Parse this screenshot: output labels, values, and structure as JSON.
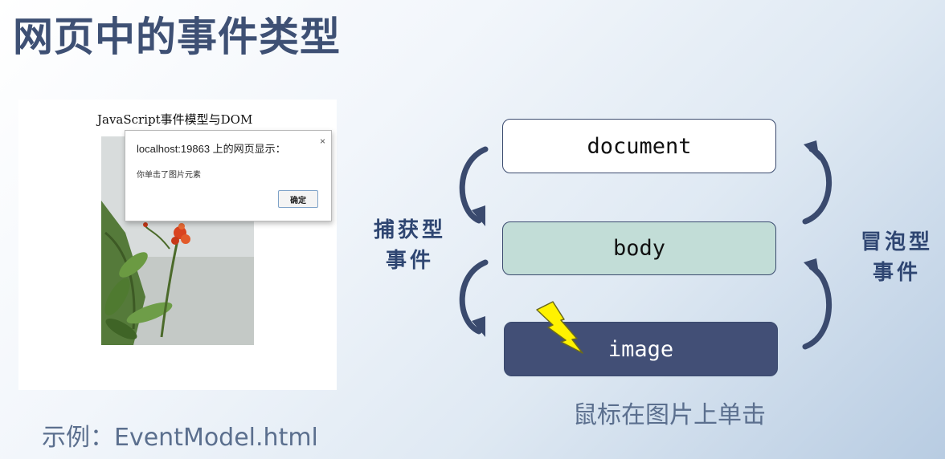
{
  "slide": {
    "title": "网页中的事件类型"
  },
  "screenshot": {
    "page_heading": "JavaScript事件模型与DOM",
    "dialog": {
      "title": "localhost:19863 上的网页显示：",
      "close": "×",
      "message": "你单击了图片元素",
      "ok_label": "确定"
    },
    "caption": "示例：EventModel.html"
  },
  "diagram": {
    "nodes": {
      "document": "document",
      "body": "body",
      "image": "image"
    },
    "capture_label": [
      "捕获型",
      "事件"
    ],
    "bubble_label": [
      "冒泡型",
      "事件"
    ],
    "click_caption": "鼠标在图片上单击",
    "colors": {
      "arrow": "#3a4a6e",
      "body_fill": "#c2ddd7",
      "image_fill": "#424f76",
      "lightning": "#fff200"
    }
  }
}
